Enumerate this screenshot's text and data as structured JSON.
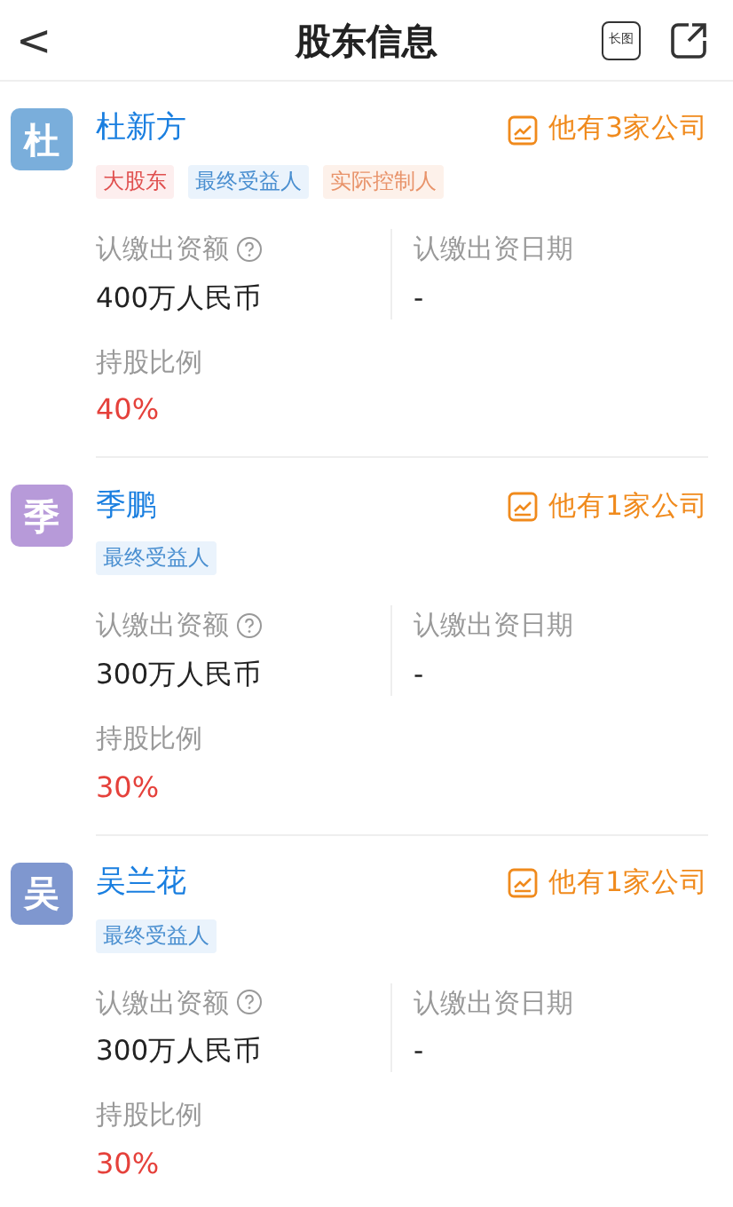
{
  "header": {
    "back": "<",
    "title": "股东信息",
    "long_image": "长图"
  },
  "shareholders": [
    {
      "avatar": "杜",
      "color": "#7aaedb",
      "name": "杜新方",
      "companies": "他有3家公司",
      "tags": [
        {
          "label": "大股东",
          "kind": "major"
        },
        {
          "label": "最终受益人",
          "kind": "beneficiary"
        },
        {
          "label": "实际控制人",
          "kind": "controller"
        }
      ],
      "amount_label": "认缴出资额",
      "amount": "400万人民币",
      "date_label": "认缴出资日期",
      "date": "-",
      "ratio_label": "持股比例",
      "ratio": "40%"
    },
    {
      "avatar": "季",
      "color": "#b79ad9",
      "name": "季鹏",
      "companies": "他有1家公司",
      "tags": [
        {
          "label": "最终受益人",
          "kind": "beneficiary"
        }
      ],
      "amount_label": "认缴出资额",
      "amount": "300万人民币",
      "date_label": "认缴出资日期",
      "date": "-",
      "ratio_label": "持股比例",
      "ratio": "30%"
    },
    {
      "avatar": "吴",
      "color": "#7f97cf",
      "name": "吴兰花",
      "companies": "他有1家公司",
      "tags": [
        {
          "label": "最终受益人",
          "kind": "beneficiary"
        }
      ],
      "amount_label": "认缴出资额",
      "amount": "300万人民币",
      "date_label": "认缴出资日期",
      "date": "-",
      "ratio_label": "持股比例",
      "ratio": "30%"
    }
  ]
}
